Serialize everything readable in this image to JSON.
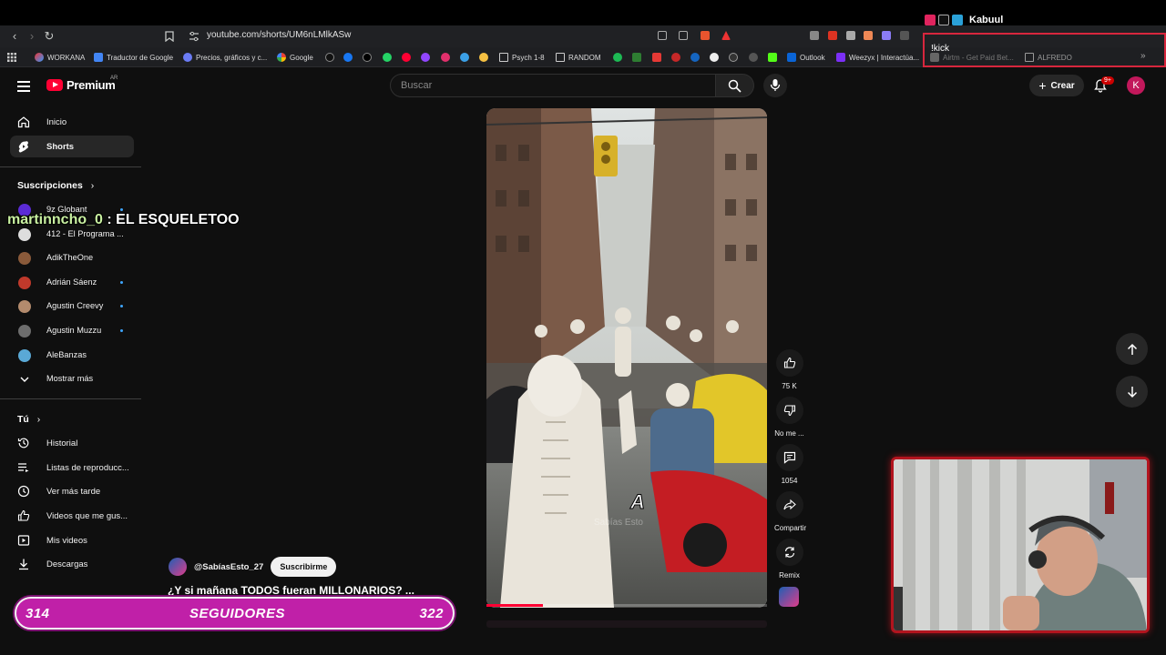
{
  "browser": {
    "url": "youtube.com/shorts/UM6nLMlkASw",
    "bookmarks": [
      "WORKANA",
      "Traductor de Google",
      "Precios, gráficos y c...",
      "Google",
      "Psych 1-8",
      "RANDOM",
      "Outlook",
      "Weezyx | Interactúa..."
    ],
    "bookmarks_right": [
      "Airtm - Get Paid Bet...",
      "ALFREDO"
    ]
  },
  "stream": {
    "top_name": "Kabuul",
    "command": "!kick",
    "chat_user": "martinncho_0",
    "chat_message": ": EL ESQUELETOO",
    "followers_current": "314",
    "followers_label": "SEGUIDORES",
    "followers_goal": "322",
    "followers_progress": 0.975
  },
  "header": {
    "logo_text": "Premium",
    "country": "AR",
    "search_placeholder": "Buscar",
    "create_label": "Crear",
    "notif_count": "9+",
    "avatar_letter": "K"
  },
  "sidebar": {
    "main": [
      {
        "label": "Inicio",
        "icon": "home-icon"
      },
      {
        "label": "Shorts",
        "icon": "shorts-icon",
        "active": true
      }
    ],
    "subscriptions_title": "Suscripciones",
    "subscriptions": [
      {
        "label": "9z Globant",
        "new": true,
        "color": "#5b2bd6"
      },
      {
        "label": "412 - El Programa ...",
        "new": false,
        "color": "#dddddd"
      },
      {
        "label": "AdikTheOne",
        "new": false,
        "color": "#8a5a3a"
      },
      {
        "label": "Adrián Sáenz",
        "new": true,
        "color": "#c0392b"
      },
      {
        "label": "Agustin Creevy",
        "new": true,
        "color": "#b38b6d"
      },
      {
        "label": "Agustin Muzzu",
        "new": true,
        "color": "#6d6d6d"
      },
      {
        "label": "AleBanzas",
        "new": false,
        "color": "#5aa9d6"
      }
    ],
    "show_more": "Mostrar más",
    "you_title": "Tú",
    "you": [
      {
        "label": "Historial",
        "icon": "history-icon"
      },
      {
        "label": "Listas de reproducc...",
        "icon": "playlists-icon"
      },
      {
        "label": "Ver más tarde",
        "icon": "watch-later-icon"
      },
      {
        "label": "Videos que me gus...",
        "icon": "liked-icon"
      },
      {
        "label": "Mis videos",
        "icon": "my-videos-icon"
      },
      {
        "label": "Descargas",
        "icon": "downloads-icon"
      }
    ]
  },
  "video": {
    "overlay_text": "A",
    "watermark": "Sabías Esto",
    "progress": 0.2,
    "channel": "@SabíasEsto_27",
    "subscribe_label": "Suscribirme",
    "title": "¿Y si mañana TODOS fueran MILLONARIOS? ...",
    "actions": [
      {
        "icon": "like-icon",
        "label": "75 K"
      },
      {
        "icon": "dislike-icon",
        "label": "No me ..."
      },
      {
        "icon": "comment-icon",
        "label": "1054"
      },
      {
        "icon": "share-icon",
        "label": "Compartir"
      },
      {
        "icon": "remix-icon",
        "label": "Remix"
      }
    ]
  }
}
